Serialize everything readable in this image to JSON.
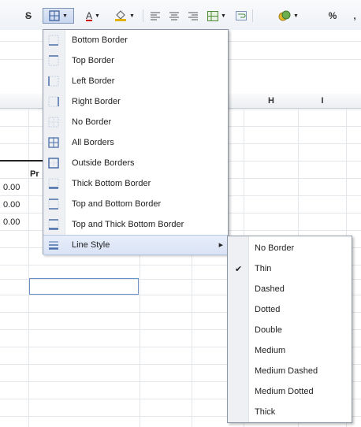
{
  "toolbar": {
    "strike_glyph": "S",
    "font_color_glyph": "A",
    "percent_label": "%",
    "comma_label": ","
  },
  "columns": {
    "h": "H",
    "i": "I"
  },
  "cells": {
    "pr": "Pr",
    "v1": "0.00",
    "v2": "0.00",
    "v3": "0.00"
  },
  "border_menu": {
    "items": [
      {
        "label": "Bottom Border",
        "icon": "bottom-border-icon"
      },
      {
        "label": "Top Border",
        "icon": "top-border-icon"
      },
      {
        "label": "Left Border",
        "icon": "left-border-icon"
      },
      {
        "label": "Right Border",
        "icon": "right-border-icon"
      },
      {
        "label": "No Border",
        "icon": "no-border-icon"
      },
      {
        "label": "All Borders",
        "icon": "all-borders-icon"
      },
      {
        "label": "Outside Borders",
        "icon": "outside-borders-icon"
      },
      {
        "label": "Thick Bottom Border",
        "icon": "thick-bottom-border-icon"
      },
      {
        "label": "Top and Bottom Border",
        "icon": "top-bottom-border-icon"
      },
      {
        "label": "Top and Thick Bottom Border",
        "icon": "top-thick-bottom-border-icon"
      },
      {
        "label": "Line Style",
        "icon": "line-style-icon",
        "has_submenu": true,
        "highlighted": true
      }
    ]
  },
  "line_style_menu": {
    "selected": "Thin",
    "items": [
      {
        "label": "No Border"
      },
      {
        "label": "Thin",
        "checked": true
      },
      {
        "label": "Dashed"
      },
      {
        "label": "Dotted"
      },
      {
        "label": "Double"
      },
      {
        "label": "Medium"
      },
      {
        "label": "Medium Dashed"
      },
      {
        "label": "Medium Dotted"
      },
      {
        "label": "Thick"
      }
    ]
  },
  "colors": {
    "menu_border": "#8f97a6",
    "highlight": "#d9e3f5",
    "icon_blue": "#4a6fa8",
    "icon_faded": "#b8c7dd"
  }
}
